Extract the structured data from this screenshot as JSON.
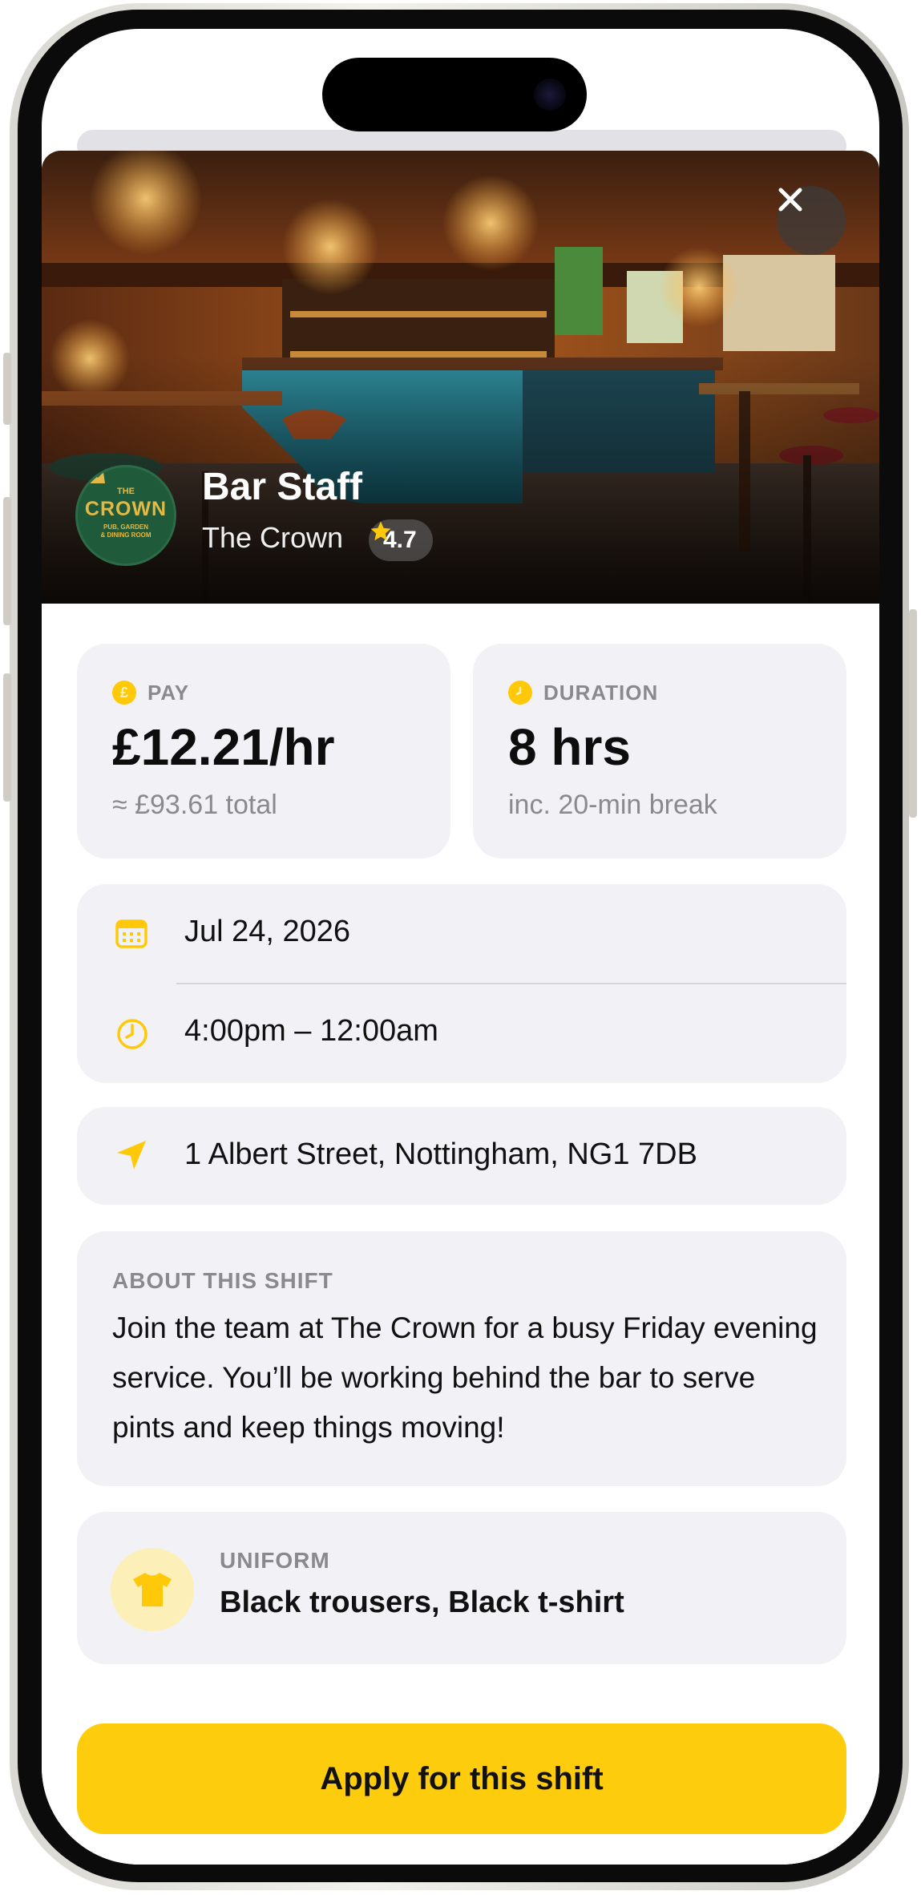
{
  "hero": {
    "title": "Bar Staff",
    "venue": "The Crown",
    "rating": "4.7",
    "logo": {
      "the": "THE",
      "name": "CROWN",
      "sub1": "PUB, GARDEN",
      "sub2": "& DINING ROOM"
    }
  },
  "stats": {
    "pay": {
      "label": "PAY",
      "value": "£12.21/hr",
      "sub": "≈ £93.61 total",
      "icon": "pound-icon"
    },
    "duration": {
      "label": "DURATION",
      "value": "8 hrs",
      "sub": "inc. 20-min break",
      "icon": "clock-icon"
    }
  },
  "schedule": {
    "date": "Jul 24, 2026",
    "time": "4:00pm – 12:00am"
  },
  "location": {
    "address": "1 Albert Street, Nottingham, NG1 7DB"
  },
  "about": {
    "label": "ABOUT THIS SHIFT",
    "text": "Join the team at The Crown for a busy Friday evening service. You’ll be working behind the bar to serve pints and keep things moving!"
  },
  "uniform": {
    "label": "UNIFORM",
    "value": "Black trousers, Black t-shirt"
  },
  "cta": {
    "label": "Apply for this shift"
  },
  "colors": {
    "accent": "#fdcc0d",
    "card": "#f2f2f6",
    "muted": "#8a8a8e"
  }
}
